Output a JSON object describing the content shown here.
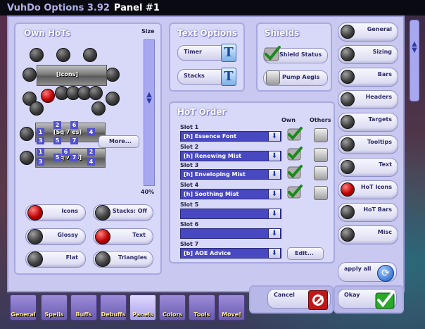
{
  "title": {
    "app": "VuhDo Options 3.92",
    "panel": "Panel #1"
  },
  "own_hots": {
    "title": "Own HoTs",
    "size_label": "Size",
    "size_value": "40%",
    "preview1_label": "[Icons]",
    "preview2_label": "[Sq 7 es]",
    "preview3_label": "[Sq 7 es]",
    "more_label": "More...",
    "numbers": [
      "1",
      "2",
      "3",
      "4",
      "5",
      "6",
      "7"
    ],
    "toggles": [
      {
        "label": "Icons"
      },
      {
        "label": "Stacks: Off"
      },
      {
        "label": "Glossy"
      },
      {
        "label": "Text"
      },
      {
        "label": "Flat"
      },
      {
        "label": "Triangles"
      }
    ]
  },
  "text_options": {
    "title": "Text Options",
    "timer_label": "Timer",
    "stacks_label": "Stacks"
  },
  "shields": {
    "title": "Shields",
    "shield_status_label": "Shield Status",
    "pump_aegis_label": "Pump Aegis"
  },
  "hot_order": {
    "title": "HoT Order",
    "own_header": "Own",
    "others_header": "Others",
    "edit_label": "Edit...",
    "slots": [
      {
        "label": "Slot 1",
        "value": "[h] Essence Font",
        "own": true
      },
      {
        "label": "Slot 2",
        "value": "[h] Renewing Mist",
        "own": true
      },
      {
        "label": "Slot 3",
        "value": "[h] Enveloping Mist",
        "own": true
      },
      {
        "label": "Slot 4",
        "value": "[h] Soothing Mist",
        "own": true
      },
      {
        "label": "Slot 5",
        "value": ""
      },
      {
        "label": "Slot 6",
        "value": ""
      },
      {
        "label": "Slot 7",
        "value": "[b] AOE Advice"
      }
    ]
  },
  "side_nav": [
    {
      "label": "General"
    },
    {
      "label": "Sizing"
    },
    {
      "label": "Bars"
    },
    {
      "label": "Headers"
    },
    {
      "label": "Targets"
    },
    {
      "label": "Tooltips"
    },
    {
      "label": "Text"
    },
    {
      "label": "HoT Icons",
      "active": true
    },
    {
      "label": "HoT Bars"
    },
    {
      "label": "Misc"
    }
  ],
  "apply_all_label": "apply all",
  "cancel_label": "Cancel",
  "okay_label": "Okay",
  "tabs": [
    {
      "label": "General"
    },
    {
      "label": "Spells"
    },
    {
      "label": "Buffs"
    },
    {
      "label": "Debuffs"
    },
    {
      "label": "Panels",
      "active": true
    },
    {
      "label": "Colors"
    },
    {
      "label": "Tools"
    },
    {
      "label": "Move!"
    }
  ],
  "colors": {
    "accent": "#4848c0",
    "frame": "#c8c8f0",
    "check": "#2aa82a",
    "cancel": "#d02020"
  }
}
